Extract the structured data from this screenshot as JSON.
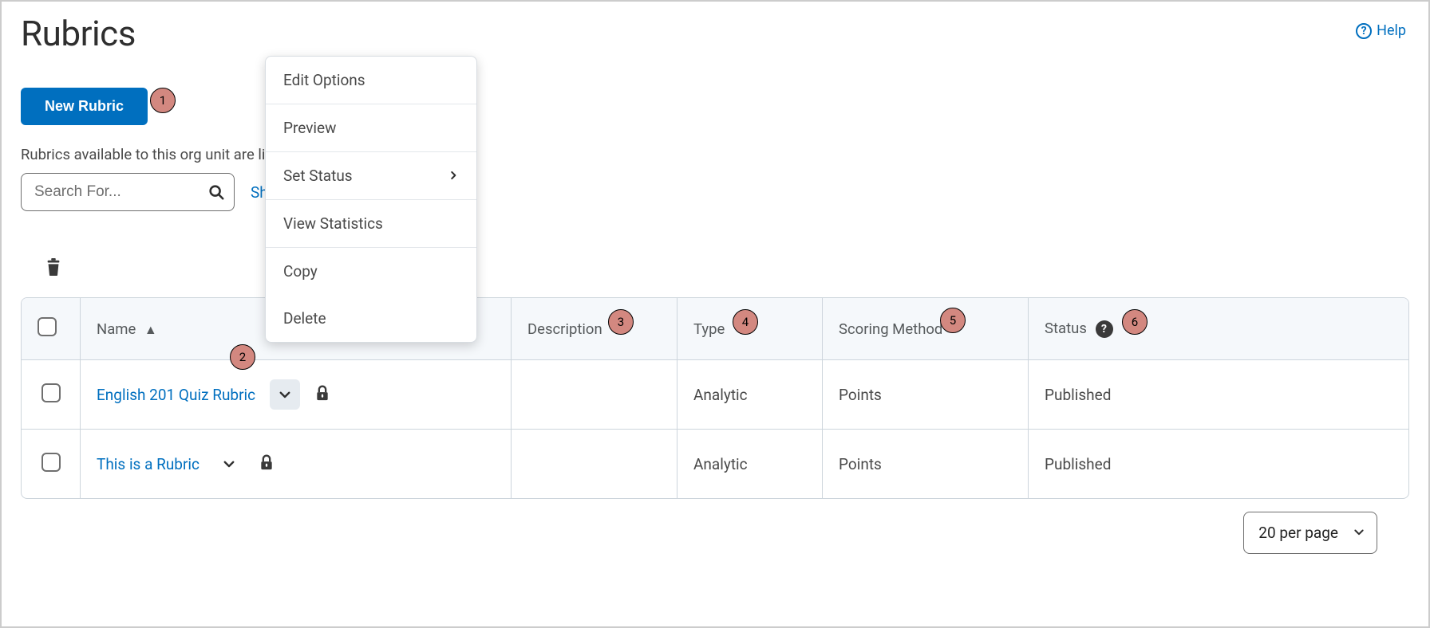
{
  "page": {
    "title": "Rubrics",
    "help_label": "Help",
    "new_button": "New Rubric",
    "subtext": "Rubrics available to this org unit are listed",
    "search_placeholder": "Search For...",
    "show_options_label": "Sh",
    "pager_label": "20 per page"
  },
  "columns": {
    "name": "Name",
    "description": "Description",
    "type": "Type",
    "scoring_method": "Scoring Method",
    "status": "Status"
  },
  "rows": [
    {
      "name": "English 201 Quiz Rubric",
      "description": "",
      "type": "Analytic",
      "method": "Points",
      "status": "Published",
      "menu_open": true
    },
    {
      "name": "This is a Rubric",
      "description": "",
      "type": "Analytic",
      "method": "Points",
      "status": "Published",
      "menu_open": false
    }
  ],
  "menu": {
    "edit_options": "Edit Options",
    "preview": "Preview",
    "set_status": "Set Status",
    "view_statistics": "View Statistics",
    "copy": "Copy",
    "delete": "Delete"
  },
  "callouts": {
    "1": "1",
    "2": "2",
    "3": "3",
    "4": "4",
    "5": "5",
    "6": "6"
  }
}
